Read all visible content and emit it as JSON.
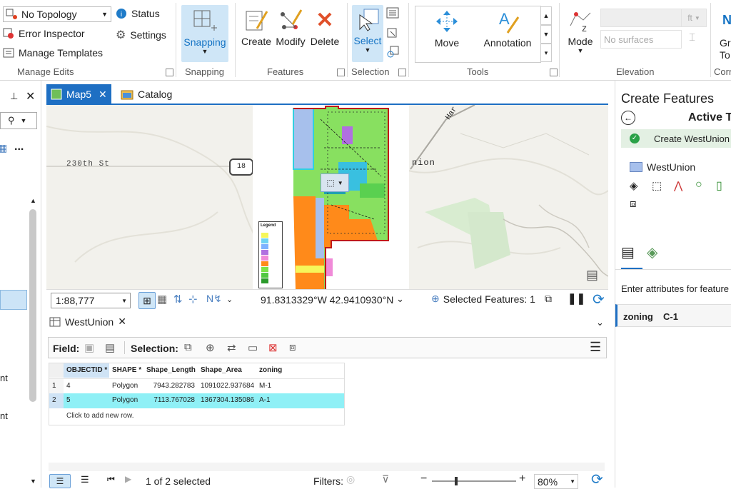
{
  "ribbon": {
    "manage_edits": {
      "topology_select": "No Topology",
      "status": "Status",
      "error_inspector": "Error Inspector",
      "settings": "Settings",
      "manage_templates": "Manage Templates",
      "group_label": "Manage Edits"
    },
    "snapping": {
      "button": "Snapping",
      "group_label": "Snapping"
    },
    "features": {
      "create": "Create",
      "modify": "Modify",
      "delete": "Delete",
      "group_label": "Features"
    },
    "selection": {
      "select": "Select",
      "group_label": "Selection"
    },
    "tools": {
      "move": "Move",
      "annotation": "Annotation",
      "group_label": "Tools"
    },
    "elevation": {
      "mode": "Mode",
      "unit": "ft",
      "surfaces_placeholder": "No surfaces",
      "group_label": "Elevation"
    },
    "corrections": {
      "label_top": "Gr",
      "label_bottom": "To",
      "group_label": "Corr"
    }
  },
  "map_view": {
    "tabs": [
      {
        "label": "Map5"
      },
      {
        "label": "Catalog"
      }
    ],
    "road_label": "230th St",
    "highway_shield": "18",
    "place_label_partial": "nion",
    "place_label_top": "Har",
    "legend_title": "Legend",
    "scale": "1:88,777",
    "coordinates": "91.8313329°W 42.9410930°N",
    "selected_features": "Selected Features: 1",
    "legend_colors": [
      "#f6f65a",
      "#6fd3f2",
      "#7fb3ff",
      "#b070e0",
      "#f08ad8",
      "#ff8a1a",
      "#7de34a",
      "#50c840",
      "#2a9a2a"
    ]
  },
  "left_panel": {
    "partial_text_1": "nt",
    "partial_text_2": "nt",
    "more": "..."
  },
  "attribute_table": {
    "tab_label": "WestUnion",
    "field_label": "Field:",
    "selection_label": "Selection:",
    "columns": [
      "OBJECTID *",
      "SHAPE *",
      "Shape_Length",
      "Shape_Area",
      "zoning"
    ],
    "rows": [
      {
        "num": "1",
        "objectid": "4",
        "shape": "Polygon",
        "length": "7943.282783",
        "area": "1091022.937684",
        "zoning": "M-1"
      },
      {
        "num": "2",
        "objectid": "5",
        "shape": "Polygon",
        "length": "7113.767028",
        "area": "1367304.135086",
        "zoning": "A-1"
      }
    ],
    "add_row_hint": "Click to add new row.",
    "status": "1 of 2 selected",
    "filters": "Filters:",
    "zoom": "80%"
  },
  "create_features": {
    "title": "Create Features",
    "active_template": "Active Te",
    "create_item": "Create WestUnion",
    "layer_name": "WestUnion",
    "enter_attributes": "Enter attributes for feature",
    "attribute_field": "zoning",
    "attribute_value": "C-1"
  }
}
